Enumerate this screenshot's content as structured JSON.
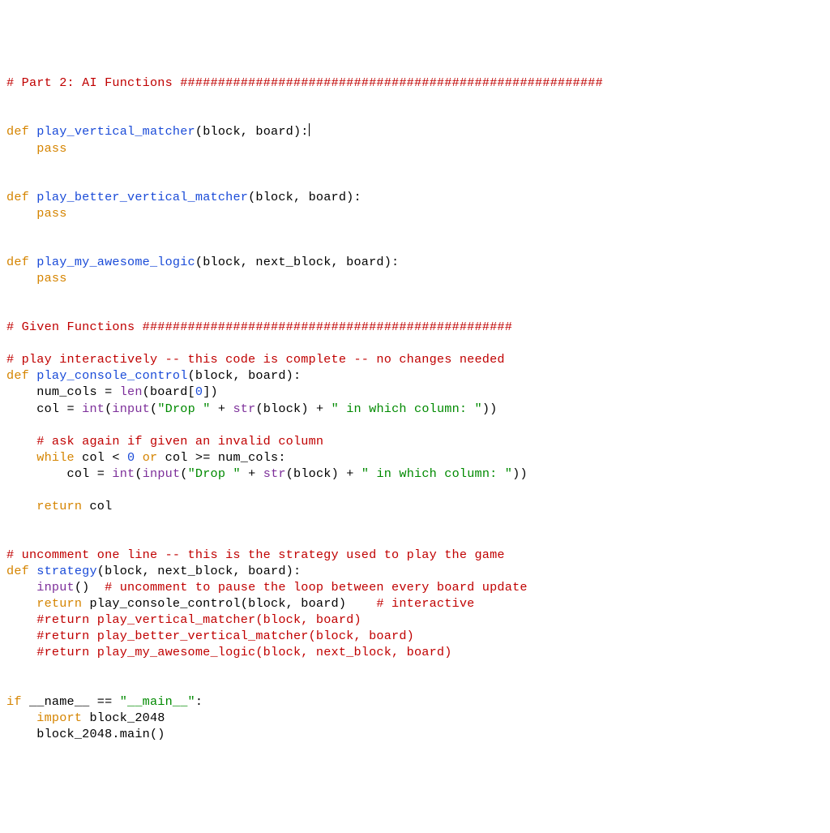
{
  "code": {
    "l01": "# Part 2: AI Functions ########################################################",
    "l03a": "def",
    "l03b": "play_vertical_matcher",
    "l03c": "(block, board):",
    "l04": "pass",
    "l07a": "def",
    "l07b": "play_better_vertical_matcher",
    "l07c": "(block, board):",
    "l08": "pass",
    "l11a": "def",
    "l11b": "play_my_awesome_logic",
    "l11c": "(block, next_block, board):",
    "l12": "pass",
    "l15": "# Given Functions #################################################",
    "l17": "# play interactively -- this code is complete -- no changes needed",
    "l18a": "def",
    "l18b": "play_console_control",
    "l18c": "(block, board):",
    "l19a": "    num_cols = ",
    "l19b": "len",
    "l19c": "(board[",
    "l19d": "0",
    "l19e": "])",
    "l20a": "    col = ",
    "l20b": "int",
    "l20c": "(",
    "l20d": "input",
    "l20e": "(",
    "l20f": "\"Drop \"",
    "l20g": " + ",
    "l20h": "str",
    "l20i": "(block) + ",
    "l20j": "\" in which column: \"",
    "l20k": "))",
    "l22": "# ask again if given an invalid column",
    "l23a": "while",
    "l23b": " col < ",
    "l23c": "0",
    "l23d": " ",
    "l23e": "or",
    "l23f": " col >= num_cols:",
    "l24a": "        col = ",
    "l24b": "int",
    "l24c": "(",
    "l24d": "input",
    "l24e": "(",
    "l24f": "\"Drop \"",
    "l24g": " + ",
    "l24h": "str",
    "l24i": "(block) + ",
    "l24j": "\" in which column: \"",
    "l24k": "))",
    "l26a": "return",
    "l26b": " col",
    "l29": "# uncomment one line -- this is the strategy used to play the game",
    "l30a": "def",
    "l30b": "strategy",
    "l30c": "(block, next_block, board):",
    "l31a": "input",
    "l31b": "()  ",
    "l31c": "# uncomment to pause the loop between every board update",
    "l32a": "return",
    "l32b": " play_console_control(block, board)    ",
    "l32c": "# interactive",
    "l33": "#return play_vertical_matcher(block, board)",
    "l34": "#return play_better_vertical_matcher(block, board)",
    "l35": "#return play_my_awesome_logic(block, next_block, board)",
    "l38a": "if",
    "l38b": " __name__ == ",
    "l38c": "\"__main__\"",
    "l38d": ":",
    "l39a": "import",
    "l39b": " block_2048",
    "l40": "    block_2048.main()"
  }
}
